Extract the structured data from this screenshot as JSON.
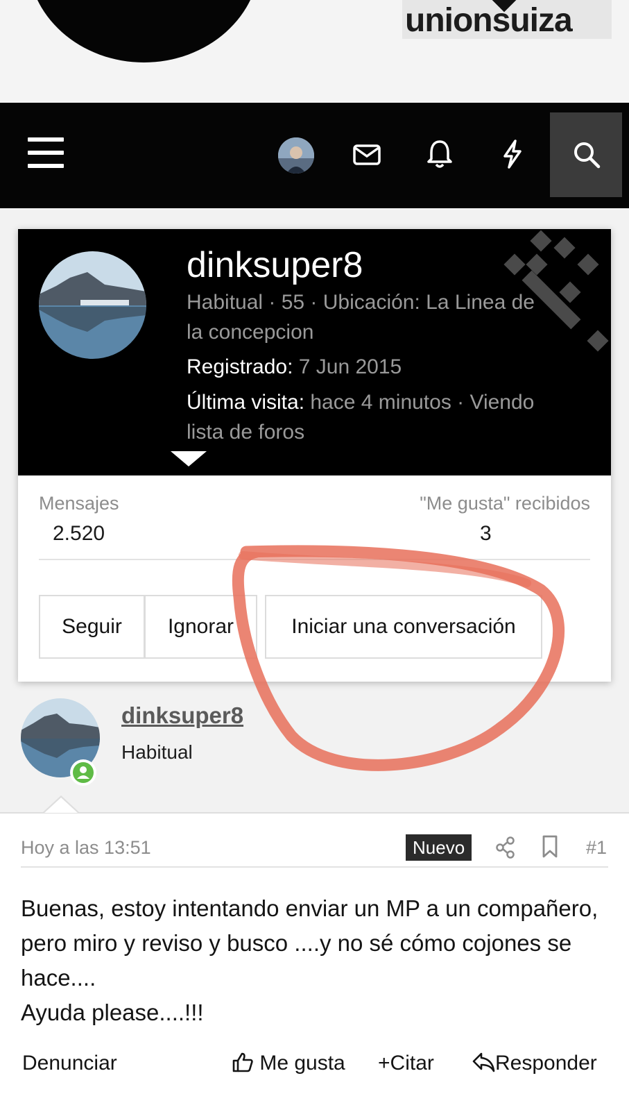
{
  "header": {
    "logo_text": "unionsuiza"
  },
  "navbar": {
    "icons": [
      "menu-icon",
      "avatar",
      "envelope-icon",
      "bell-icon",
      "bolt-icon",
      "search-icon"
    ],
    "search_bg": "#3b3b3b"
  },
  "profile_card": {
    "username": "dinksuper8",
    "rank_line": "Habitual · 55 · Ubicación: La Linea de la concepcion",
    "registered_label": "Registrado:",
    "registered_value": "7 Jun 2015",
    "last_visit_label": "Última visita:",
    "last_visit_value": "hace 4 minutos · Viendo lista de foros",
    "stats": {
      "messages_label": "Mensajes",
      "messages_value": "2.520",
      "likes_label": "\"Me gusta\" recibidos",
      "likes_value": "3"
    },
    "buttons": {
      "follow": "Seguir",
      "ignore": "Ignorar",
      "start_conversation": "Iniciar una conversación"
    }
  },
  "post": {
    "author": "dinksuper8",
    "author_title": "Habitual",
    "timestamp": "Hoy a las 13:51",
    "badge": "Nuevo",
    "number": "#1",
    "body": "Buenas, estoy intentando enviar un MP a un compañero, pero miro y reviso y busco ....y no sé cómo cojones se hace....",
    "body_line2": "Ayuda please....!!!",
    "actions": {
      "report": "Denunciar",
      "like": "Me gusta",
      "quote": "Citar",
      "reply": "Responder"
    }
  },
  "colors": {
    "annotation": "#e8705a",
    "online": "#5fbb46",
    "badge_bg": "#2b2b2b"
  }
}
